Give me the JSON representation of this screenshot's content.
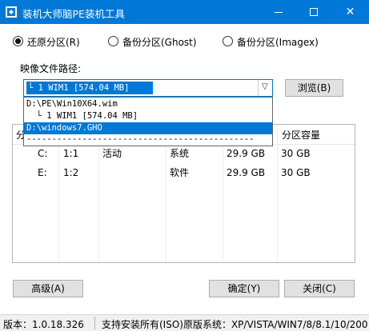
{
  "window": {
    "title": "装机大师脑PE装机工具",
    "icon": "app-icon",
    "controls": {
      "minimize": "minimize-icon",
      "maximize": "maximize-icon",
      "close": "✕"
    }
  },
  "modes": [
    {
      "label": "还原分区(R)",
      "checked": true
    },
    {
      "label": "备份分区(Ghost)",
      "checked": false
    },
    {
      "label": "备份分区(Imagex)",
      "checked": false
    }
  ],
  "image_path": {
    "label": "映像文件路径:",
    "selected": "└ 1 WIM1 [574.04 MB]",
    "browse_label": "浏览(B)",
    "options": [
      "D:\\PE\\Win10X64.wim",
      "  └ 1 WIM1 [574.04 MB]",
      "D:\\windows7.GHO",
      "---------------------------------------------"
    ]
  },
  "table": {
    "headers": [
      "分",
      "",
      "",
      "",
      "",
      "分区容量"
    ],
    "rows": [
      [
        "C:",
        "1:1",
        "活动",
        "系统",
        "29.9 GB",
        "30 GB"
      ],
      [
        "E:",
        "1:2",
        "",
        "软件",
        "29.9 GB",
        "30 GB"
      ]
    ]
  },
  "buttons": {
    "advanced": "高级(A)",
    "ok": "确定(Y)",
    "close": "关闭(C)"
  },
  "status": {
    "version": "版本：1.0.18.326",
    "supported": "支持安装所有(ISO)原版系统：XP/VISTA/WIN7/8/8.1/10/200"
  },
  "colors": {
    "accent": "#0078d7",
    "button_bg": "#e1e1e1",
    "status_bg": "#f0f0f0"
  }
}
